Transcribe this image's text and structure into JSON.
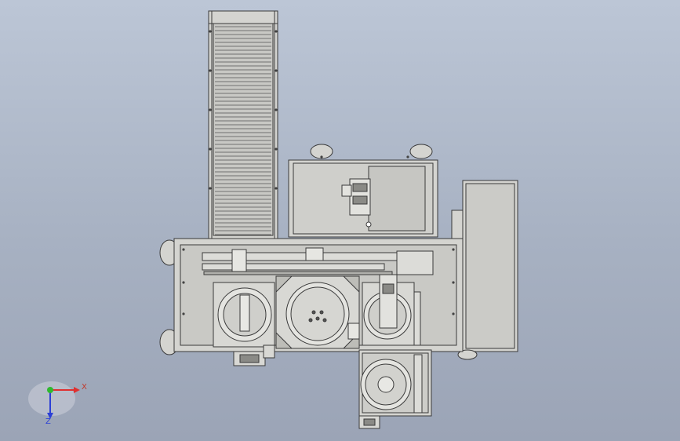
{
  "viewport": {
    "background_top": "#bcc6d6",
    "background_bottom": "#9ba4b6"
  },
  "model": {
    "part_fill": "#d4d4d0",
    "part_fill_dark": "#bdbdb8",
    "edge_color": "#3a3a3a",
    "detail_color": "#5a5a5a"
  },
  "triad": {
    "x_label": "X",
    "z_label": "Z",
    "x_color": "#e03030",
    "y_color": "#2fb82f",
    "z_color": "#2b3fd6",
    "icons": [
      "axis-triad-icon"
    ]
  }
}
